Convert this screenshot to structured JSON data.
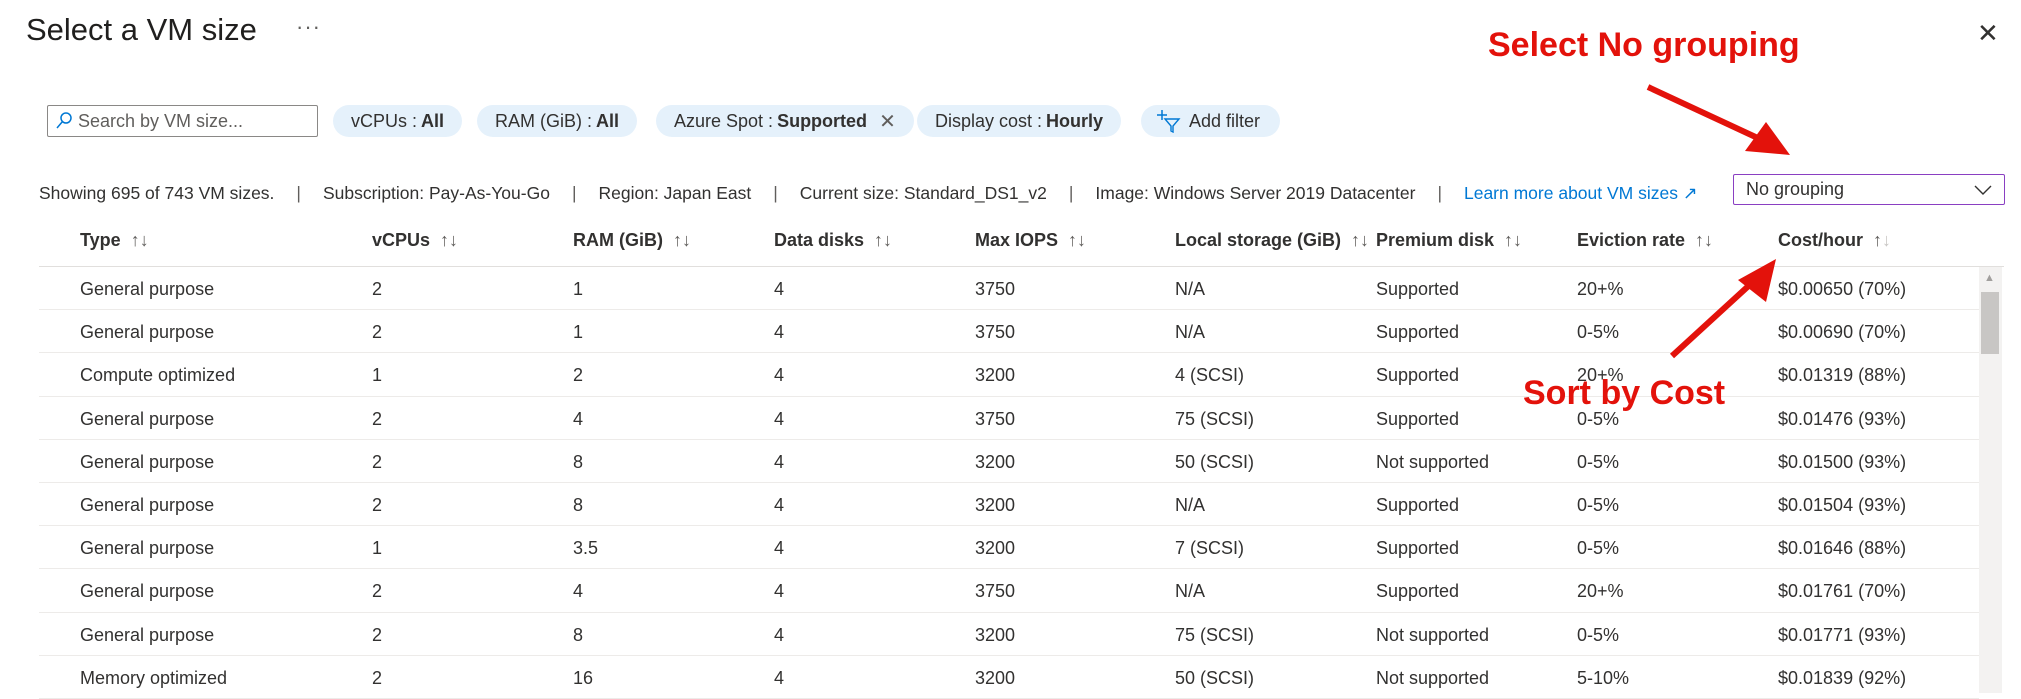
{
  "header": {
    "title": "Select a VM size",
    "more_icon": "ellipsis-icon",
    "close_icon": "close-icon"
  },
  "search": {
    "placeholder": "Search by VM size...",
    "value": ""
  },
  "filters": [
    {
      "label": "vCPUs :",
      "value": "All"
    },
    {
      "label": "RAM (GiB) :",
      "value": "All"
    },
    {
      "label": "Azure Spot :",
      "value": "Supported",
      "removable": true
    },
    {
      "label": "Display cost :",
      "value": "Hourly"
    }
  ],
  "add_filter": "Add filter",
  "info": {
    "showing": "Showing 695 of 743 VM sizes.",
    "subscription": "Subscription: Pay-As-You-Go",
    "region": "Region: Japan East",
    "current_size": "Current size: Standard_DS1_v2",
    "image": "Image: Windows Server 2019 Datacenter",
    "learn_more": "Learn more about VM sizes"
  },
  "grouping": {
    "selected": "No grouping"
  },
  "columns": [
    "Type",
    "vCPUs",
    "RAM (GiB)",
    "Data disks",
    "Max IOPS",
    "Local storage (GiB)",
    "Premium disk",
    "Eviction rate",
    "Cost/hour"
  ],
  "sort": {
    "column": "Cost/hour",
    "direction": "ascending"
  },
  "rows": [
    [
      "General purpose",
      "2",
      "1",
      "4",
      "3750",
      "N/A",
      "Supported",
      "20+%",
      "$0.00650 (70%)"
    ],
    [
      "General purpose",
      "2",
      "1",
      "4",
      "3750",
      "N/A",
      "Supported",
      "0-5%",
      "$0.00690 (70%)"
    ],
    [
      "Compute optimized",
      "1",
      "2",
      "4",
      "3200",
      "4 (SCSI)",
      "Supported",
      "20+%",
      "$0.01319 (88%)"
    ],
    [
      "General purpose",
      "2",
      "4",
      "4",
      "3750",
      "75 (SCSI)",
      "Supported",
      "0-5%",
      "$0.01476 (93%)"
    ],
    [
      "General purpose",
      "2",
      "8",
      "4",
      "3200",
      "50 (SCSI)",
      "Not supported",
      "0-5%",
      "$0.01500 (93%)"
    ],
    [
      "General purpose",
      "2",
      "8",
      "4",
      "3200",
      "N/A",
      "Supported",
      "0-5%",
      "$0.01504 (93%)"
    ],
    [
      "General purpose",
      "1",
      "3.5",
      "4",
      "3200",
      "7 (SCSI)",
      "Supported",
      "0-5%",
      "$0.01646 (88%)"
    ],
    [
      "General purpose",
      "2",
      "4",
      "4",
      "3750",
      "N/A",
      "Supported",
      "20+%",
      "$0.01761 (70%)"
    ],
    [
      "General purpose",
      "2",
      "8",
      "4",
      "3200",
      "75 (SCSI)",
      "Not supported",
      "0-5%",
      "$0.01771 (93%)"
    ],
    [
      "Memory optimized",
      "2",
      "16",
      "4",
      "3200",
      "50 (SCSI)",
      "Not supported",
      "5-10%",
      "$0.01839 (92%)"
    ]
  ],
  "annotations": {
    "grouping": "Select No grouping",
    "sort": "Sort by Cost",
    "color": "#e3120b"
  }
}
